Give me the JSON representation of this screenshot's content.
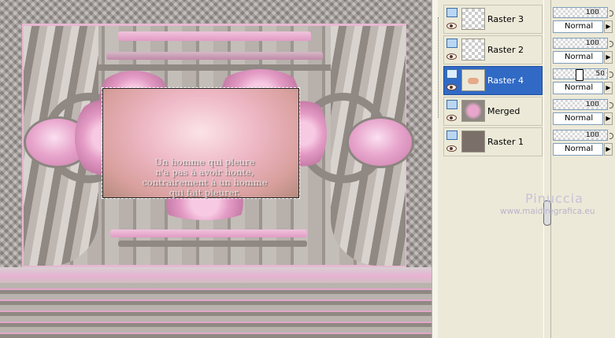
{
  "canvas": {
    "overlay_text": [
      "Un homme qui pleure",
      "n'a pas à avoir honte,",
      "contrairement à un homme",
      "qui fait pleurer."
    ],
    "watermark_name": "Pinuccia",
    "watermark_url": "www.maidiregrafica.eu",
    "accent_pink": "#e8a6cd",
    "frame_pink": "#e7b8d2"
  },
  "layers": {
    "selected_color": "#316ac5",
    "items": [
      {
        "name": "Raster 3",
        "opacity": "100",
        "blend": "Normal",
        "selected": false,
        "thumb": "transparent"
      },
      {
        "name": "Raster 2",
        "opacity": "100",
        "blend": "Normal",
        "selected": false,
        "thumb": "transparent"
      },
      {
        "name": "Raster 4",
        "opacity": "50",
        "blend": "Normal",
        "selected": true,
        "thumb": "pink-blob"
      },
      {
        "name": "Merged",
        "opacity": "100",
        "blend": "Normal",
        "selected": false,
        "thumb": "merged"
      },
      {
        "name": "Raster 1",
        "opacity": "100",
        "blend": "Normal",
        "selected": false,
        "thumb": "solid"
      }
    ],
    "icons": {
      "layer_type": "raster-layer-icon",
      "visibility": "eye-icon",
      "lock": "lock-icon",
      "dropdown": "dropdown-arrow-icon"
    }
  }
}
